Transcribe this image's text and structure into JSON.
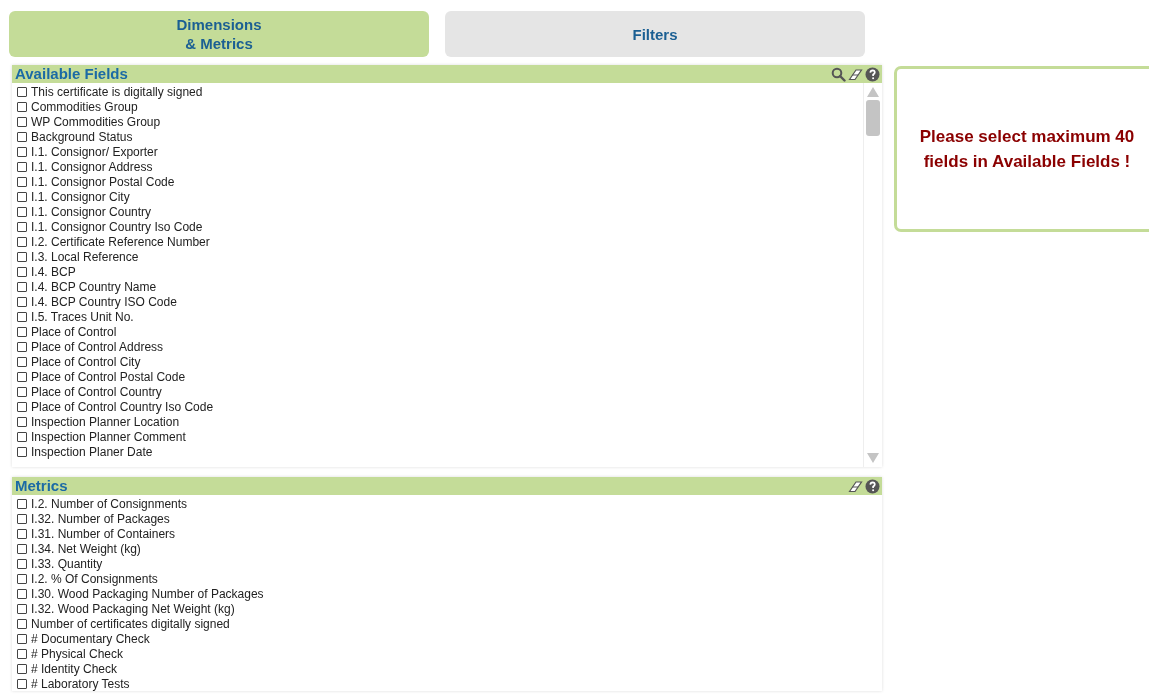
{
  "tabs": [
    {
      "label": "Dimensions\n& Metrics",
      "selected": true
    },
    {
      "label": "Filters",
      "selected": false
    }
  ],
  "available_fields": {
    "title": "Available Fields",
    "items": [
      {
        "label": "This certificate is digitally signed",
        "checked": false
      },
      {
        "label": "Commodities Group",
        "checked": false
      },
      {
        "label": "WP Commodities Group",
        "checked": false
      },
      {
        "label": "Background Status",
        "checked": false
      },
      {
        "label": "I.1. Consignor/ Exporter",
        "checked": false
      },
      {
        "label": "I.1. Consignor Address",
        "checked": false
      },
      {
        "label": "I.1. Consignor Postal Code",
        "checked": false
      },
      {
        "label": "I.1. Consignor City",
        "checked": false
      },
      {
        "label": "I.1. Consignor Country",
        "checked": false
      },
      {
        "label": "I.1. Consignor Country Iso Code",
        "checked": false
      },
      {
        "label": "I.2. Certificate Reference Number",
        "checked": false
      },
      {
        "label": "I.3. Local Reference",
        "checked": false
      },
      {
        "label": "I.4. BCP",
        "checked": false
      },
      {
        "label": "I.4. BCP Country Name",
        "checked": false
      },
      {
        "label": "I.4. BCP Country ISO Code",
        "checked": false
      },
      {
        "label": "I.5. Traces Unit No.",
        "checked": false
      },
      {
        "label": "Place of Control",
        "checked": false
      },
      {
        "label": "Place of Control Address",
        "checked": false
      },
      {
        "label": "Place of Control City",
        "checked": false
      },
      {
        "label": "Place of Control Postal Code",
        "checked": false
      },
      {
        "label": "Place of Control Country",
        "checked": false
      },
      {
        "label": "Place of Control Country Iso Code",
        "checked": false
      },
      {
        "label": "Inspection Planner Location",
        "checked": false
      },
      {
        "label": "Inspection Planner Comment",
        "checked": false
      },
      {
        "label": "Inspection Planer Date",
        "checked": false
      }
    ]
  },
  "metrics": {
    "title": "Metrics",
    "items": [
      {
        "label": "I.2. Number of Consignments",
        "checked": false
      },
      {
        "label": "I.32. Number of Packages",
        "checked": false
      },
      {
        "label": "I.31. Number of Containers",
        "checked": false
      },
      {
        "label": "I.34. Net Weight (kg)",
        "checked": false
      },
      {
        "label": "I.33. Quantity",
        "checked": false
      },
      {
        "label": "I.2. % Of Consignments",
        "checked": false
      },
      {
        "label": "I.30. Wood Packaging Number of Packages",
        "checked": false
      },
      {
        "label": "I.32. Wood Packaging Net Weight (kg)",
        "checked": false
      },
      {
        "label": "Number of certificates digitally signed",
        "checked": false
      },
      {
        "label": "# Documentary Check",
        "checked": false
      },
      {
        "label": "# Physical Check",
        "checked": false
      },
      {
        "label": "# Identity Check",
        "checked": false
      },
      {
        "label": "# Laboratory Tests",
        "checked": false
      }
    ]
  },
  "message": "Please select maximum 40 fields in Available Fields !"
}
